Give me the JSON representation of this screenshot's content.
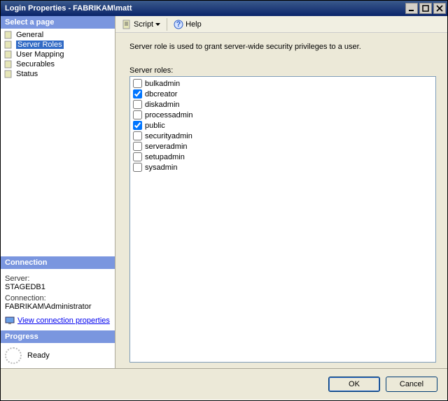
{
  "window": {
    "title": "Login Properties - FABRIKAM\\matt"
  },
  "sidebar": {
    "select_header": "Select a page",
    "pages": [
      {
        "label": "General",
        "selected": false
      },
      {
        "label": "Server Roles",
        "selected": true
      },
      {
        "label": "User Mapping",
        "selected": false
      },
      {
        "label": "Securables",
        "selected": false
      },
      {
        "label": "Status",
        "selected": false
      }
    ],
    "connection_header": "Connection",
    "server_label": "Server:",
    "server_value": "STAGEDB1",
    "connection_label": "Connection:",
    "connection_value": "FABRIKAM\\Administrator",
    "view_conn_link": "View connection properties",
    "progress_header": "Progress",
    "progress_status": "Ready"
  },
  "toolbar": {
    "script_label": "Script",
    "help_label": "Help"
  },
  "main": {
    "description": "Server role is used to grant server-wide security privileges to a user.",
    "roles_label": "Server roles:",
    "roles": [
      {
        "name": "bulkadmin",
        "checked": false
      },
      {
        "name": "dbcreator",
        "checked": true
      },
      {
        "name": "diskadmin",
        "checked": false
      },
      {
        "name": "processadmin",
        "checked": false
      },
      {
        "name": "public",
        "checked": true
      },
      {
        "name": "securityadmin",
        "checked": false
      },
      {
        "name": "serveradmin",
        "checked": false
      },
      {
        "name": "setupadmin",
        "checked": false
      },
      {
        "name": "sysadmin",
        "checked": false
      }
    ]
  },
  "buttons": {
    "ok": "OK",
    "cancel": "Cancel"
  }
}
